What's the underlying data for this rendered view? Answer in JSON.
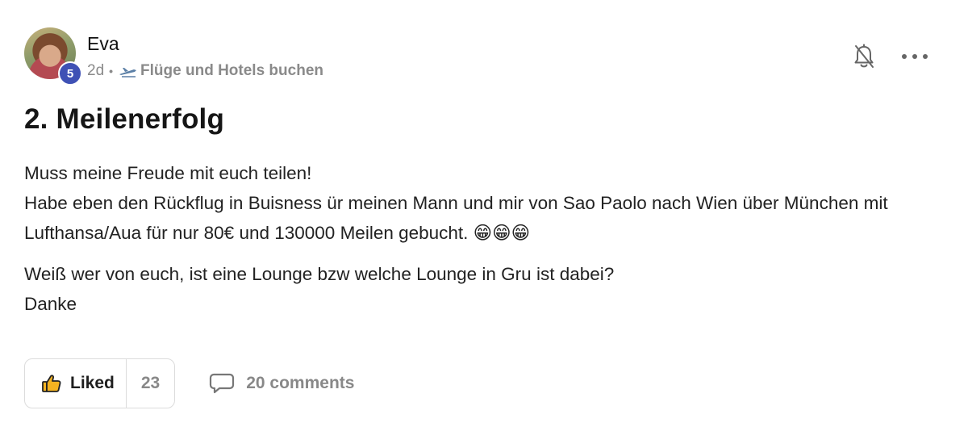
{
  "author": {
    "name": "Eva",
    "level": "5"
  },
  "meta": {
    "time": "2d",
    "separator": "•",
    "category": "Flüge und Hotels buchen"
  },
  "post": {
    "title": "2. Meilenerfolg",
    "paragraph1": "Muss meine Freude mit euch teilen!\nHabe eben den Rückflug in Buisness ür meinen Mann und mir von Sao Paolo nach Wien über München mit Lufthansa/Aua für nur 80€ und 130000 Meilen gebucht. 😁😁😁",
    "paragraph2": "Weiß wer von euch, ist eine Lounge bzw welche Lounge in Gru ist dabei?\nDanke"
  },
  "actions": {
    "like_label": "Liked",
    "like_count": "23",
    "comments_label": "20 comments"
  },
  "colors": {
    "badge": "#3f51b5",
    "muted": "#888888",
    "border": "#dcdcdc"
  },
  "icons": [
    "avatar",
    "airplane-icon",
    "bell-off-icon",
    "more-icon",
    "thumbs-up-icon",
    "comment-icon"
  ]
}
